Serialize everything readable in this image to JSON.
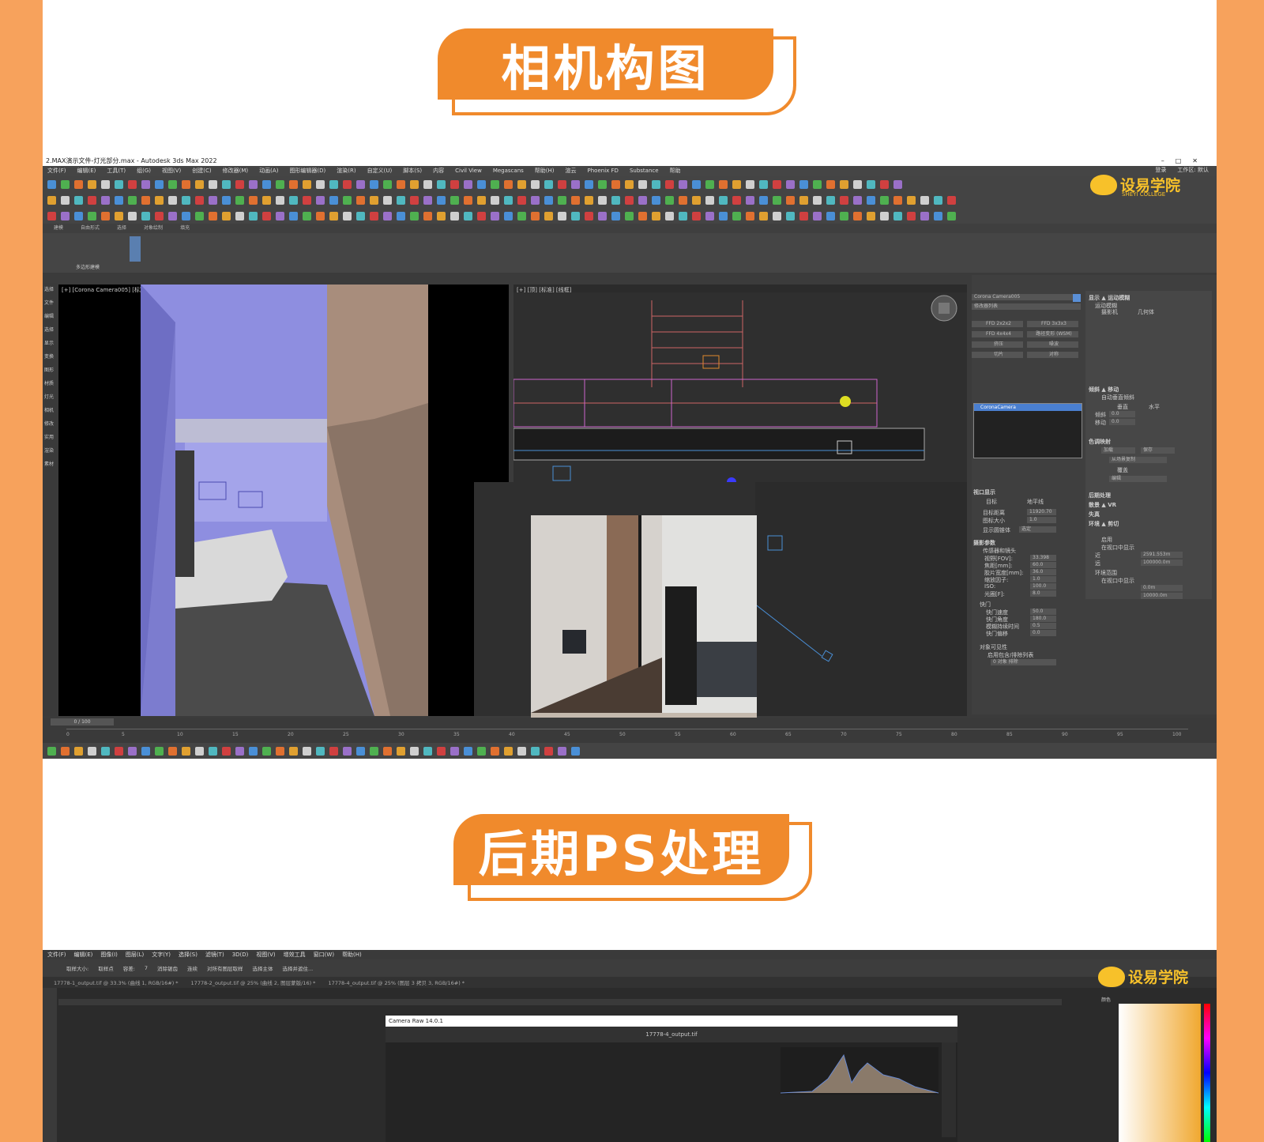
{
  "section1": {
    "title": "相机构图"
  },
  "section2": {
    "title": "后期PS处理"
  },
  "max": {
    "window_title": "2.MAX演示文件-灯光部分.max - Autodesk 3ds Max 2022",
    "menu": [
      "文件(F)",
      "编辑(E)",
      "工具(T)",
      "组(G)",
      "视图(V)",
      "创建(C)",
      "修改器(M)",
      "动画(A)",
      "图形编辑器(D)",
      "渲染(R)",
      "自定义(U)",
      "脚本(S)",
      "内容",
      "Civil View",
      "Megascans",
      "帮助(H)",
      "渲云",
      "Phoenix FD",
      "Substance",
      "帮助"
    ],
    "login": "登录",
    "workspace": "工作区: 默认",
    "left_viewport_label": "[+] [Corona Camera005] [标准] [默认明暗处理]",
    "right_viewport_label": "[+] [顶] [标准] [线框]",
    "left_tools": [
      "选择",
      "文件",
      "编辑",
      "选择",
      "显示",
      "变换",
      "图形",
      "材质",
      "灯光",
      "相机",
      "修改",
      "实用",
      "渲染",
      "素材"
    ],
    "ribbon_tabs": [
      "建模",
      "自由形式",
      "选择",
      "对象绘制",
      "填充"
    ],
    "poly_label": "多边形建模",
    "frame_counter": "0 / 100",
    "timeline_ticks": [
      "0",
      "5",
      "10",
      "15",
      "20",
      "25",
      "30",
      "35",
      "40",
      "45",
      "50",
      "55",
      "60",
      "65",
      "70",
      "75",
      "80",
      "85",
      "90",
      "95",
      "100"
    ],
    "cmd": {
      "object_name": "Corona Camera005",
      "modifier_list": "修改器列表",
      "buttons": [
        "FFD 2x2x2",
        "FFD 3x3x3",
        "FFD 4x4x4",
        "路径变形 (WSM)",
        "挤压",
        "噪波",
        "切片",
        "对称"
      ],
      "stack_item": "CoronaCamera",
      "viewport_display": "视口显示",
      "target": "目标",
      "horizon": "地平线",
      "target_distance": "目标距离",
      "target_distance_val": "11920.70",
      "icon_size": "图标大小",
      "icon_size_val": "1.0",
      "show_cone": "显示圆锥体",
      "show_cone_val": "选定",
      "camera_params": "摄影参数",
      "sensor": "传感器和镜头",
      "fov": "视野[FOV]:",
      "fov_val": "33.398",
      "focal": "焦距[mm]:",
      "focal_val": "60.0",
      "sensor_width": "胶片宽度[mm]:",
      "sensor_width_val": "36.0",
      "zoom": "缩放因子:",
      "zoom_val": "1.0",
      "iso": "ISO:",
      "iso_val": "100.0",
      "fstop": "光圈[F]:",
      "fstop_val": "8.0",
      "shutter": "快门",
      "shutter_speed": "快门速度",
      "shutter_speed_val": "50.0",
      "shutter_angle": "快门角度",
      "shutter_angle_val": "180.0",
      "motion_blur_dur": "模糊持续时间",
      "motion_blur_dur_val": "0.5",
      "shutter_offset": "快门偏移",
      "shutter_offset_val": "0.0",
      "visibility": "对象可见性",
      "include_list": "启用包含/排除列表",
      "include_val": "0 对象  排除"
    },
    "cmd2": {
      "adjust": "显示 ▲ 运动模糊",
      "motion": "运动模糊",
      "camera": "摄影机",
      "geometry": "几何体",
      "cc": "色调映射",
      "tilt": "倾斜 ▲ 移动",
      "auto_tilt": "自动垂直倾斜",
      "vertical": "垂直",
      "horizontal": "水平",
      "tilt_label": "倾斜",
      "tilt_val": "0.0",
      "shift_label": "移动",
      "shift_val": "0.0",
      "tone": "色调映射",
      "load": "加载",
      "save": "保存",
      "from_scene": "从场景复制",
      "override": "覆盖",
      "edit": "编辑",
      "post": "后期处理",
      "bokeh": "散景 ▲ VR",
      "lens": "失真",
      "clip": "环境 ▲ 剪切",
      "clip_enable": "启用",
      "show_clip": "在视口中显示",
      "near": "近",
      "near_val": "2591.553m",
      "far": "远",
      "far_val": "100000.0m",
      "env_range": "环境范围",
      "show_env": "在视口中显示",
      "env_near": "0.0m",
      "env_far": "10000.0m"
    }
  },
  "ps": {
    "menu": [
      "文件(F)",
      "编辑(E)",
      "图像(I)",
      "图层(L)",
      "文字(Y)",
      "选择(S)",
      "滤镜(T)",
      "3D(D)",
      "视图(V)",
      "增效工具",
      "窗口(W)",
      "帮助(H)"
    ],
    "options": [
      "取样大小:",
      "取样点",
      "容差:",
      "7",
      "消除锯齿",
      "连续",
      "对所有图层取样",
      "选择主体",
      "选择并遮住..."
    ],
    "tabs": [
      "17778-1_output.tif @ 33.3% (曲线 1, RGB/16#) *",
      "17778-2_output.tif @ 25% (曲线 2, 图层蒙版/16) *",
      "17778-4_output.tif @ 25% (图层 3 拷贝 3, RGB/16#) *"
    ],
    "dialog_title": "Camera Raw 14.0.1",
    "filename": "17778-4_output.tif",
    "side_label": "颜色"
  },
  "logo": {
    "text": "设易学院",
    "sub": "SHEYI COLLEGE"
  },
  "colors": {
    "accent": "#F08A2C",
    "frame": "#F7A25C",
    "logo": "#F7C12A",
    "viewport_purple": "#8E8EE0"
  }
}
